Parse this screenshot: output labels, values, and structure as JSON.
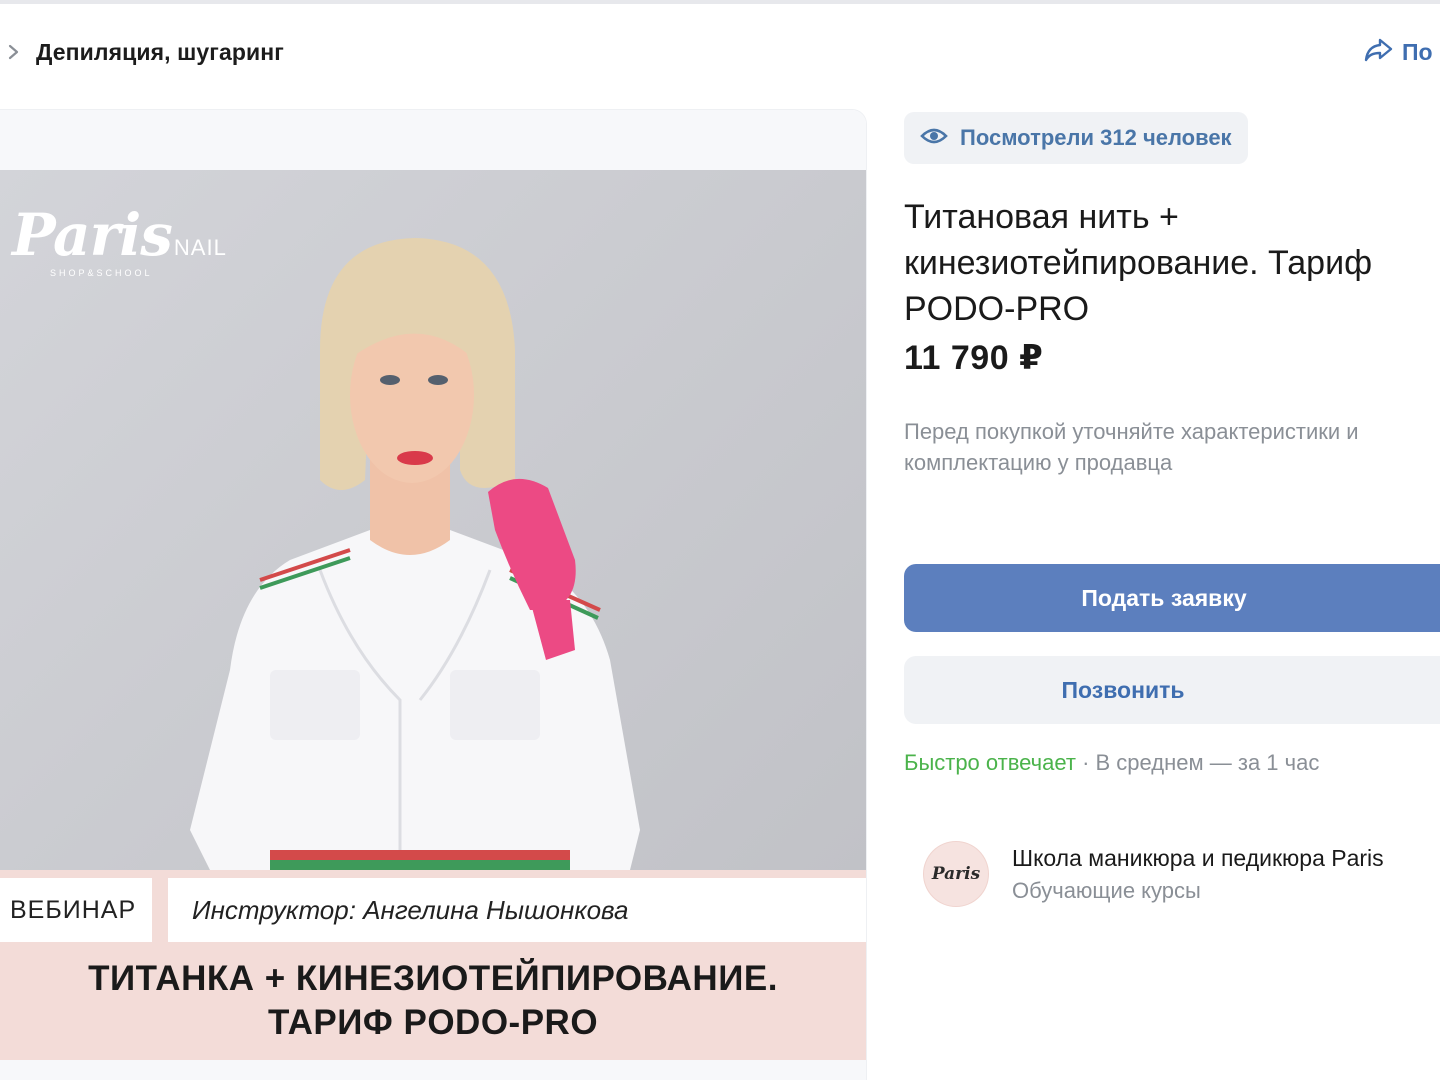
{
  "breadcrumb": {
    "title": "Депиляция, шугаринг",
    "share_label": "По"
  },
  "product": {
    "views": "Посмотрели 312 человек",
    "title": "Титановая нить + кинезиотейпирование. Тариф PODO-PRO",
    "price": "11 790 ₽",
    "notice": "Перед покупкой уточняйте характеристики и комплектацию у продавца"
  },
  "actions": {
    "apply": "Подать заявку",
    "call": "Позвонить"
  },
  "reply": {
    "fast": "Быстро отвечает",
    "avg": " · В среднем — за 1 час"
  },
  "seller": {
    "name": "Школа маникюра и педикюра Paris",
    "category": "Обучающие курсы",
    "avatar_text": "Paris"
  },
  "banner": {
    "brand_script": "Paris",
    "brand_nail": "NAIL",
    "brand_sub": "SHOP&SCHOOL",
    "tag_webinar": "ВЕБИНАР",
    "tag_instructor": "Инструктор: Ангелина Нышонкова",
    "headline_1": "ТИТАНКА + КИНЕЗИОТЕЙПИРОВАНИЕ.",
    "headline_2": "ТАРИФ PODO-PRO"
  },
  "colors": {
    "accent": "#5c7fbe",
    "link": "#3f6eb0",
    "fast_reply": "#4bb34b",
    "muted": "#8a8f96",
    "banner_pink": "#f3dcd8",
    "glove": "#ec4a84"
  },
  "icons": {
    "breadcrumb": "chevron-right-icon",
    "share": "share-arrow-icon",
    "views": "eye-icon"
  }
}
